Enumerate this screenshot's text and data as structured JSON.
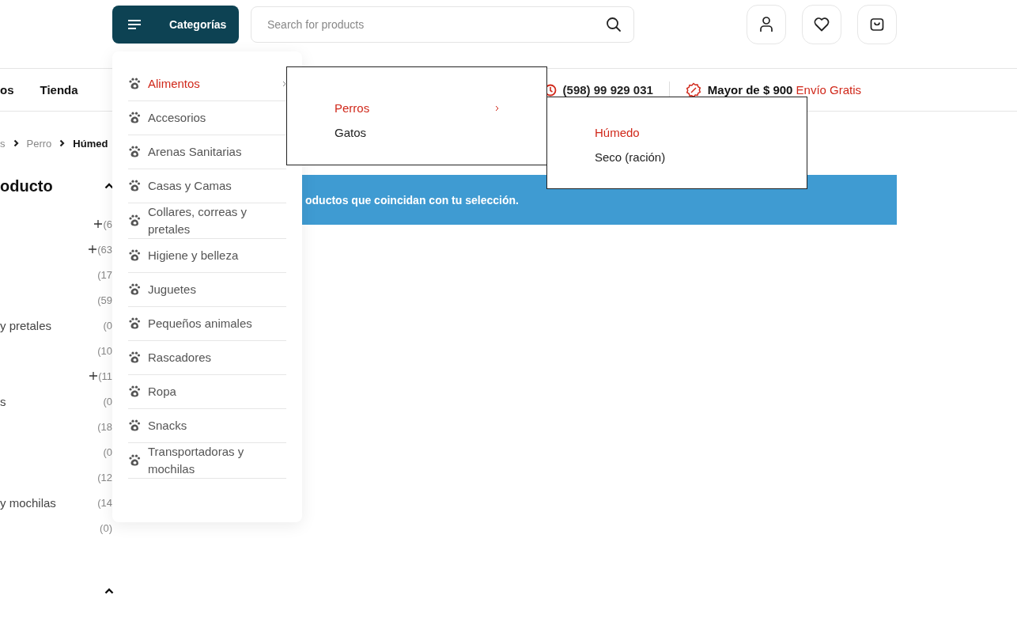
{
  "header": {
    "categories_button": "Categorías",
    "search": {
      "placeholder": "Search for products"
    }
  },
  "nav": {
    "items": [
      {
        "label": "os"
      },
      {
        "label": "Tienda"
      }
    ],
    "phone": "(598) 99 929 031",
    "shipping": {
      "text": "Mayor de $ 900",
      "highlight": "Envío Gratis"
    }
  },
  "breadcrumb": [
    "s",
    "Perro",
    "Húmed"
  ],
  "filter": {
    "title": "oducto",
    "expanded": true,
    "rows": [
      {
        "count": "(6",
        "expandable": true
      },
      {
        "count": "(63",
        "expandable": true
      },
      {
        "count": "(17",
        "expandable": false
      },
      {
        "count": "(59",
        "expandable": false
      },
      {
        "label": "y pretales",
        "count": "(0",
        "expandable": false
      },
      {
        "count": "(10",
        "expandable": false
      },
      {
        "count": "(11",
        "expandable": true
      },
      {
        "label": "s",
        "count": "(0",
        "expandable": false
      },
      {
        "count": "(18",
        "expandable": false
      },
      {
        "count": "(0",
        "expandable": false
      },
      {
        "count": "(12",
        "expandable": false
      },
      {
        "label": "y mochilas",
        "count": "(14",
        "expandable": false
      },
      {
        "count": "(0)",
        "expandable": false
      }
    ]
  },
  "second_filter": {
    "expanded": true
  },
  "notice": "oductos que coincidan con tu selección.",
  "menu": {
    "items": [
      {
        "label": "Alimentos",
        "selected": true,
        "has_children": true
      },
      {
        "label": "Accesorios",
        "selected": false,
        "has_children": false
      },
      {
        "label": "Arenas Sanitarias",
        "selected": false,
        "has_children": false
      },
      {
        "label": "Casas y Camas",
        "selected": false,
        "has_children": false
      },
      {
        "label": "Collares, correas y pretales",
        "selected": false,
        "has_children": false
      },
      {
        "label": "Higiene y belleza",
        "selected": false,
        "has_children": false
      },
      {
        "label": "Juguetes",
        "selected": false,
        "has_children": false
      },
      {
        "label": "Pequeños animales",
        "selected": false,
        "has_children": false
      },
      {
        "label": "Rascadores",
        "selected": false,
        "has_children": false
      },
      {
        "label": "Ropa",
        "selected": false,
        "has_children": false
      },
      {
        "label": "Snacks",
        "selected": false,
        "has_children": false
      },
      {
        "label": "Transportadoras y mochilas",
        "selected": false,
        "has_children": false
      }
    ]
  },
  "submenu": {
    "items": [
      {
        "label": "Perros",
        "selected": true,
        "has_children": true
      },
      {
        "label": "Gatos",
        "selected": false,
        "has_children": false
      }
    ]
  },
  "submenu_2": {
    "items": [
      {
        "label": "Húmedo",
        "selected": true
      },
      {
        "label": "Seco (ración)",
        "selected": false
      }
    ]
  }
}
